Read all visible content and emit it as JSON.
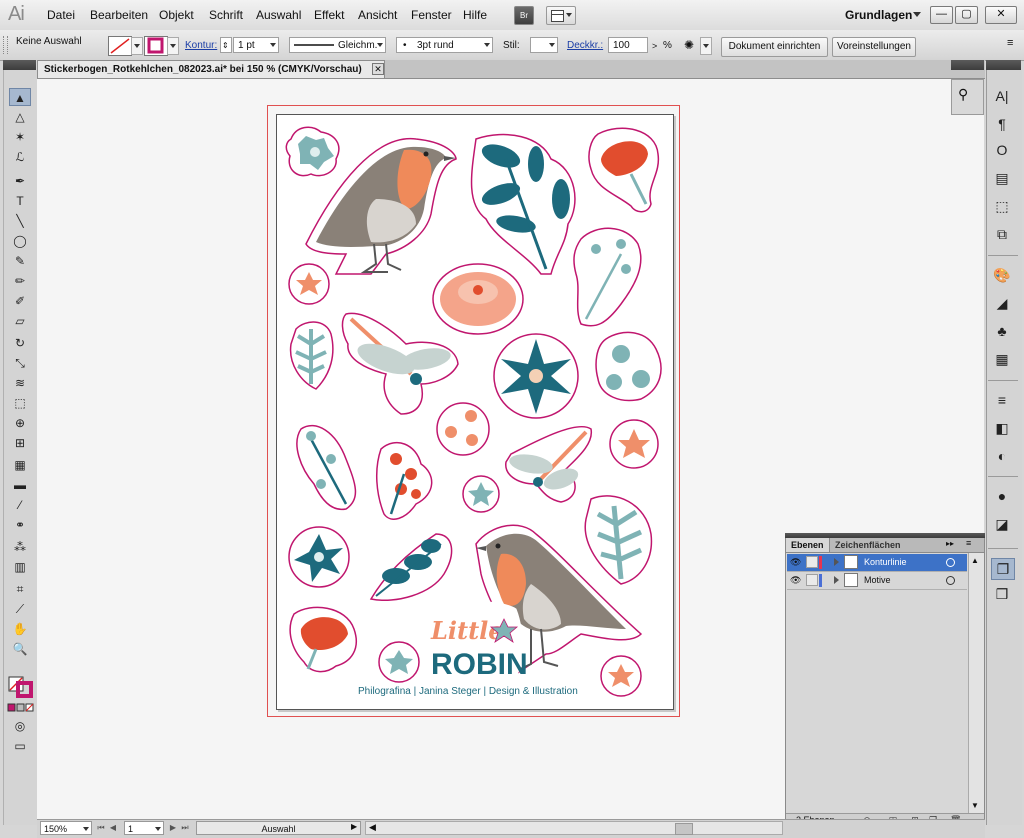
{
  "app": {
    "logo": "Ai"
  },
  "menubar": {
    "items": [
      "Datei",
      "Bearbeiten",
      "Objekt",
      "Schrift",
      "Auswahl",
      "Effekt",
      "Ansicht",
      "Fenster",
      "Hilfe"
    ],
    "bridge_label": "Br",
    "workspace": "Grundlagen",
    "window_buttons": [
      "—",
      "▢",
      "✕"
    ]
  },
  "controlbar": {
    "selection_status": "Keine Auswahl",
    "stroke_label": "Kontur:",
    "stroke_weight": "1 pt",
    "stroke_profile": "Gleichm.",
    "brush": "3pt rund",
    "style_label": "Stil:",
    "opacity_label": "Deckkr.:",
    "opacity_value": "100",
    "opacity_unit": "%",
    "document_setup": "Dokument einrichten",
    "preferences": "Voreinstellungen",
    "colors": {
      "fill_none": "#ffffff",
      "stroke": "#c0166e"
    }
  },
  "document": {
    "tab_title": "Stickerbogen_Rotkehlchen_082023.ai* bei 150 % (CMYK/Vorschau)",
    "close": "✕"
  },
  "artwork": {
    "title_line1": "Little",
    "title_line2": "ROBIN",
    "footer": "Philografina | Janina Steger | Design & Illustration",
    "colors": {
      "teal": "#1d6a7d",
      "light_teal": "#7fb3b5",
      "coral": "#ef8f6a",
      "red": "#e14d2e",
      "outline": "#c0166e",
      "grey": "#8a8a8a"
    }
  },
  "tools": {
    "items": [
      {
        "name": "selection-tool-icon",
        "glyph": "▲"
      },
      {
        "name": "direct-selection-tool-icon",
        "glyph": "△"
      },
      {
        "name": "magic-wand-tool-icon",
        "glyph": "✶"
      },
      {
        "name": "lasso-tool-icon",
        "glyph": "ℒ"
      },
      {
        "name": "pen-tool-icon",
        "glyph": "✒"
      },
      {
        "name": "type-tool-icon",
        "glyph": "T"
      },
      {
        "name": "line-tool-icon",
        "glyph": "╲"
      },
      {
        "name": "ellipse-tool-icon",
        "glyph": "◯"
      },
      {
        "name": "paintbrush-tool-icon",
        "glyph": "✎"
      },
      {
        "name": "pencil-tool-icon",
        "glyph": "✏"
      },
      {
        "name": "blob-brush-tool-icon",
        "glyph": "✐"
      },
      {
        "name": "eraser-tool-icon",
        "glyph": "▱"
      },
      {
        "name": "rotate-tool-icon",
        "glyph": "↻"
      },
      {
        "name": "scale-tool-icon",
        "glyph": "⤡"
      },
      {
        "name": "warp-tool-icon",
        "glyph": "≋"
      },
      {
        "name": "free-transform-tool-icon",
        "glyph": "⬚"
      },
      {
        "name": "shape-builder-tool-icon",
        "glyph": "⊕"
      },
      {
        "name": "perspective-grid-tool-icon",
        "glyph": "⊞"
      },
      {
        "name": "mesh-tool-icon",
        "glyph": "▦"
      },
      {
        "name": "gradient-tool-icon",
        "glyph": "▬"
      },
      {
        "name": "eyedropper-tool-icon",
        "glyph": "⁄"
      },
      {
        "name": "blend-tool-icon",
        "glyph": "⚭"
      },
      {
        "name": "symbol-sprayer-tool-icon",
        "glyph": "⁂"
      },
      {
        "name": "column-graph-tool-icon",
        "glyph": "▥"
      },
      {
        "name": "artboard-tool-icon",
        "glyph": "⌗"
      },
      {
        "name": "slice-tool-icon",
        "glyph": "⟋"
      },
      {
        "name": "hand-tool-icon",
        "glyph": "✋"
      },
      {
        "name": "zoom-tool-icon",
        "glyph": "🔍"
      }
    ]
  },
  "right_dock": {
    "icons": [
      "character-icon",
      "paragraph-icon",
      "opentype-icon",
      "align-icon",
      "transform-icon",
      "pathfinder-icon",
      "swatches-icon",
      "gradient-icon",
      "symbols-icon",
      "graphic-styles-icon",
      "stroke-icon",
      "transparency-icon",
      "appearance-icon",
      "brushes-icon",
      "layers-icon",
      "artboards-icon"
    ],
    "glyphs": [
      "A|",
      "¶",
      "O",
      "▤",
      "⬚",
      "⧉",
      "🎨",
      "◢",
      "♣",
      "▦",
      "≡",
      "◧",
      "◐",
      "●",
      "◪",
      "❐",
      "❒"
    ]
  },
  "layers_panel": {
    "tabs": [
      "Ebenen",
      "Zeichenflächen"
    ],
    "layers": [
      {
        "name": "Konturlinie",
        "color": "#e8344f",
        "selected": true
      },
      {
        "name": "Motive",
        "color": "#4a6fd6",
        "selected": false
      }
    ],
    "count_label": "2 Ebenen"
  },
  "statusbar": {
    "zoom": "150%",
    "page": "1",
    "status": "Auswahl"
  }
}
